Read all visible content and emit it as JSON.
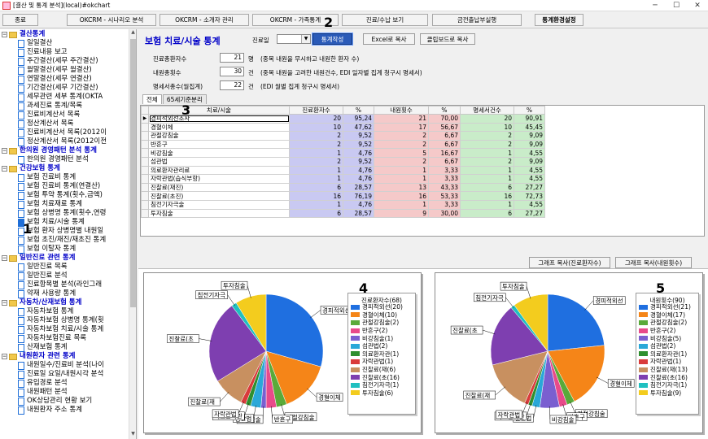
{
  "window": {
    "title": "[결산 및 통계 분석](local)#okchart",
    "min": "─",
    "max": "☐",
    "close": "✕"
  },
  "toolbar": {
    "buttons": [
      {
        "label": "종료"
      },
      {
        "label": "OKCRM - 시나리오 분석"
      },
      {
        "label": "OKCRM - 소개자 관리"
      },
      {
        "label": "OKCRM - 가족통계"
      },
      {
        "label": "진료/수납 보기"
      },
      {
        "label": "금전출납부실행"
      },
      {
        "label": "통계환경설정"
      }
    ]
  },
  "sidebar": {
    "items": [
      {
        "label": "결산통계",
        "type": "cat"
      },
      {
        "label": "일일결산",
        "type": "doc"
      },
      {
        "label": "진료내용 보고",
        "type": "doc"
      },
      {
        "label": "주간결산(세무 주간결산)",
        "type": "doc"
      },
      {
        "label": "월말결산(세무 월결산)",
        "type": "doc"
      },
      {
        "label": "연말결산(세무 연결산)",
        "type": "doc"
      },
      {
        "label": "기간결산(세무 기간결산)",
        "type": "doc"
      },
      {
        "label": "세무관련 세부 통계(OKTA",
        "type": "doc"
      },
      {
        "label": "과세진료 통계/목록",
        "type": "doc"
      },
      {
        "label": "진료비계산서 목록",
        "type": "doc"
      },
      {
        "label": "정산계산서 목록",
        "type": "doc"
      },
      {
        "label": "진료비계산서 목록(2012이",
        "type": "doc"
      },
      {
        "label": "정산계산서 목록(2012이전",
        "type": "doc"
      },
      {
        "label": "한의원 경영패턴 분석 통계",
        "type": "cat"
      },
      {
        "label": "한의원 경영패턴 분석",
        "type": "doc"
      },
      {
        "label": "건강보험 통계",
        "type": "cat"
      },
      {
        "label": "보험 진료비 통계",
        "type": "doc"
      },
      {
        "label": "보험 진료비 통계(연결산)",
        "type": "doc"
      },
      {
        "label": "보험 투약 통계(횟수,금액)",
        "type": "doc"
      },
      {
        "label": "보험 치료재료 통계",
        "type": "doc"
      },
      {
        "label": "보험 상병명 통계(횟수,연령",
        "type": "doc"
      },
      {
        "label": "보험 치료/시술 통계",
        "type": "doc",
        "selected": true
      },
      {
        "label": "보험 환자 상병명별 내원일",
        "type": "doc"
      },
      {
        "label": "보험 초진/재진/재초진 통계",
        "type": "doc"
      },
      {
        "label": "보험 이탈자 통계",
        "type": "doc"
      },
      {
        "label": "일반진료 관련 통계",
        "type": "cat"
      },
      {
        "label": "일반진료 목록",
        "type": "doc"
      },
      {
        "label": "일반진료 분석",
        "type": "doc"
      },
      {
        "label": "진료항목별 분석(라인그래",
        "type": "doc"
      },
      {
        "label": "약재 사용량 통계",
        "type": "doc"
      },
      {
        "label": "자동차/산재보험 통계",
        "type": "cat"
      },
      {
        "label": "자동차보험 통계",
        "type": "doc"
      },
      {
        "label": "자동차보험 상병명 통계(횟",
        "type": "doc"
      },
      {
        "label": "자동차보험 치료/시술 통계",
        "type": "doc"
      },
      {
        "label": "자동차보험진료 목록",
        "type": "doc"
      },
      {
        "label": "산재보험 통계",
        "type": "doc"
      },
      {
        "label": "내원환자 관련 통계",
        "type": "cat"
      },
      {
        "label": "내원일수/진료비 분석(나이",
        "type": "doc"
      },
      {
        "label": "진료일 요일/내원시각 분석",
        "type": "doc"
      },
      {
        "label": "유입경로 분석",
        "type": "doc"
      },
      {
        "label": "내원패턴 분석",
        "type": "doc"
      },
      {
        "label": "OK상담관리 현황 보기",
        "type": "doc"
      },
      {
        "label": "내원환자 주소 통계",
        "type": "doc"
      }
    ]
  },
  "main": {
    "title": "보험 치료/시술 통계",
    "filter_label": "진료일",
    "filter_value": "",
    "btn_create": "통계작성",
    "btn_excel": "Excel로 복사",
    "btn_clipboard": "클립보드로 복사",
    "summary": [
      {
        "label": "진료총환자수",
        "value": "21",
        "unit": "명",
        "note": "(중복 내원을 무시하고 내원한 환자 수)"
      },
      {
        "label": "내원총횟수",
        "value": "30",
        "unit": "건",
        "note": "(중복 내원을 고려한 내원건수, EDI 일자별 집계 청구시 명세서)"
      },
      {
        "label": "명세서총수(월집계)",
        "value": "22",
        "unit": "건",
        "note": "(EDI 월별 집계 청구시 명세서)"
      }
    ],
    "tabs": [
      {
        "label": "전체"
      },
      {
        "label": "65세기준분리"
      }
    ],
    "table": {
      "headers": [
        "치료/시술",
        "진료환자수",
        "%",
        "내원횟수",
        "%",
        "명세서건수",
        "%"
      ],
      "rows": [
        [
          "경피적외선조사",
          "20",
          "95,24",
          "21",
          "70,00",
          "20",
          "90,91"
        ],
        [
          "경혈이체",
          "10",
          "47,62",
          "17",
          "56,67",
          "10",
          "45,45"
        ],
        [
          "관절강침술",
          "2",
          "9,52",
          "2",
          "6,67",
          "2",
          "9,09"
        ],
        [
          "반흔구",
          "2",
          "9,52",
          "2",
          "6,67",
          "2",
          "9,09"
        ],
        [
          "비강침술",
          "1",
          "4,76",
          "5",
          "16,67",
          "1",
          "4,55"
        ],
        [
          "섬관법",
          "2",
          "9,52",
          "2",
          "6,67",
          "2",
          "9,09"
        ],
        [
          "의료환자관리료",
          "1",
          "4,76",
          "1",
          "3,33",
          "1",
          "4,55"
        ],
        [
          "자락관법(습식부항)",
          "1",
          "4,76",
          "1",
          "3,33",
          "1",
          "4,55"
        ],
        [
          "진찰료(재진)",
          "6",
          "28,57",
          "13",
          "43,33",
          "6",
          "27,27"
        ],
        [
          "진찰료(초진)",
          "16",
          "76,19",
          "16",
          "53,33",
          "16",
          "72,73"
        ],
        [
          "침전기자극술",
          "1",
          "4,76",
          "1",
          "3,33",
          "1",
          "4,55"
        ],
        [
          "투자침술",
          "6",
          "28,57",
          "9",
          "30,00",
          "6",
          "27,27"
        ]
      ]
    },
    "btn_graph_patients": "그래프 복사(진료환자수)",
    "btn_graph_visits": "그래프 복사(내원횟수)"
  },
  "annotations": [
    "1",
    "2",
    "3",
    "4",
    "5"
  ],
  "chart_data": [
    {
      "type": "pie",
      "title": "진료환자수",
      "total_label": "(68)",
      "categories": [
        "경피적외선",
        "경혈이체",
        "관절강침술",
        "반흔구",
        "비강침술",
        "섬관법",
        "의료환자관",
        "자락관법",
        "진찰료(재",
        "진찰료(초",
        "침전기자극",
        "투자침술"
      ],
      "values": [
        20,
        10,
        2,
        2,
        1,
        2,
        1,
        1,
        6,
        16,
        1,
        6
      ],
      "legend_labels": [
        "경피적외선(20)",
        "경혈이체(10)",
        "관절강침술(2)",
        "반흔구(2)",
        "비강침술(1)",
        "섬관법(2)",
        "의료환자관(1)",
        "자락관법(1)",
        "진찰료(재(6)",
        "진찰료(초(16)",
        "침전기자극(1)",
        "투자침술(6)"
      ],
      "colors": [
        "#1f6fe0",
        "#f58518",
        "#5aaa3a",
        "#e84a8a",
        "#7a5fd0",
        "#2aa8d8",
        "#2f8f2f",
        "#d93b3b",
        "#c89060",
        "#7e3fb0",
        "#20c0c0",
        "#f3cc1e"
      ],
      "legend": "right"
    },
    {
      "type": "pie",
      "title": "내원횟수",
      "total_label": "(90)",
      "categories": [
        "경피적외선",
        "경혈이체",
        "관절강침술",
        "반흔구",
        "비강침술",
        "섬관법",
        "의료환자관",
        "자락관법",
        "진찰료(재",
        "진찰료(초",
        "침전기자극",
        "투자침술"
      ],
      "values": [
        21,
        17,
        2,
        2,
        5,
        2,
        1,
        1,
        13,
        16,
        1,
        9
      ],
      "legend_labels": [
        "경피적외선(21)",
        "경혈이체(17)",
        "관절강침술(2)",
        "반흔구(2)",
        "비강침술(5)",
        "섬관법(2)",
        "의료환자관(1)",
        "자락관법(1)",
        "진찰료(재(13)",
        "진찰료(초(16)",
        "침전기자극(1)",
        "투자침술(9)"
      ],
      "colors": [
        "#1f6fe0",
        "#f58518",
        "#5aaa3a",
        "#e84a8a",
        "#7a5fd0",
        "#2aa8d8",
        "#2f8f2f",
        "#d93b3b",
        "#c89060",
        "#7e3fb0",
        "#20c0c0",
        "#f3cc1e"
      ],
      "legend": "right"
    }
  ]
}
